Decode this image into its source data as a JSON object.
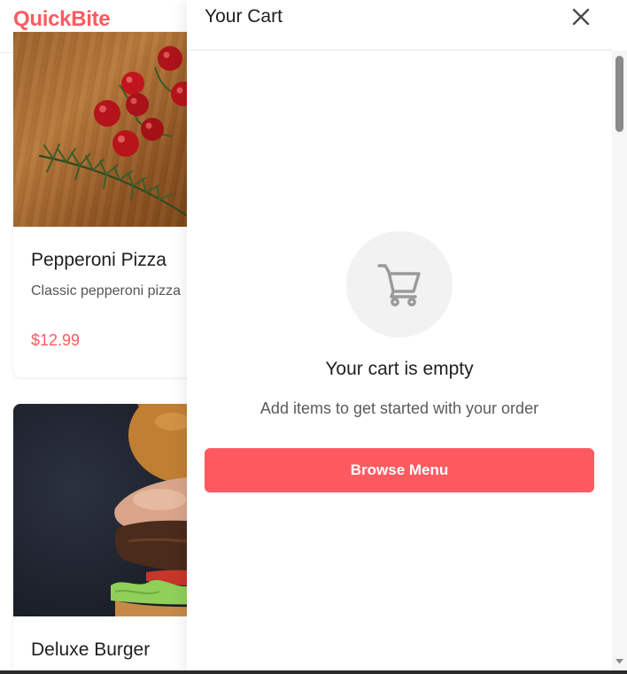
{
  "app": {
    "brand": "QuickBite"
  },
  "menu": {
    "items": [
      {
        "title": "Pepperoni Pizza",
        "description": "Classic pepperoni pizza",
        "price": "$12.99"
      },
      {
        "title": "Deluxe Burger"
      }
    ]
  },
  "cart": {
    "title": "Your Cart",
    "empty_title": "Your cart is empty",
    "empty_subtitle": "Add items to get started with your order",
    "browse_label": "Browse Menu",
    "icons": {
      "close": "close-icon",
      "cart": "cart-icon"
    }
  },
  "colors": {
    "brand": "#ff5a5f",
    "text": "#1f1f1f",
    "muted": "#5b5b5b",
    "empty_circle": "#f2f2f2"
  }
}
